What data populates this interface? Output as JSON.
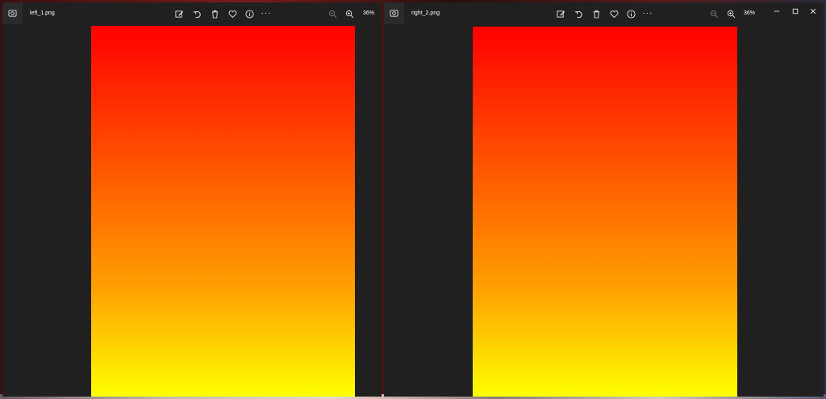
{
  "left_window": {
    "filename": "left_1.png",
    "zoom": "36%",
    "toolbar_icons": [
      "edit-icon",
      "rotate-icon",
      "delete-icon",
      "heart-icon",
      "info-icon",
      "more-icon"
    ],
    "more_label": "···"
  },
  "right_window": {
    "filename": "right_2.png",
    "zoom": "36%",
    "toolbar_icons": [
      "edit-icon",
      "rotate-icon",
      "delete-icon",
      "heart-icon",
      "info-icon",
      "more-icon"
    ],
    "more_label": "···",
    "window_controls": [
      "minimize-icon",
      "maximize-icon",
      "close-icon"
    ]
  },
  "colors": {
    "window_bg": "#202020",
    "gradient_top": "#ff0000",
    "gradient_bottom": "#ffff00",
    "text": "#ffffff"
  }
}
